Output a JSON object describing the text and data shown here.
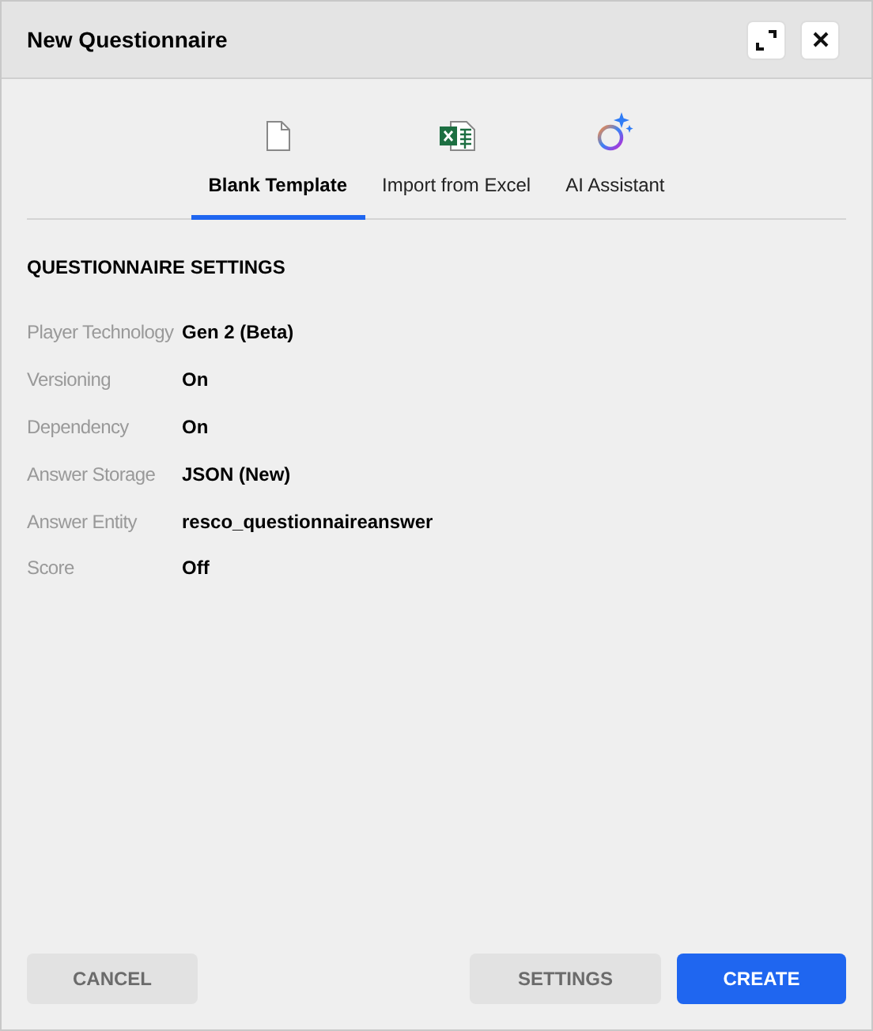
{
  "window": {
    "title": "New Questionnaire"
  },
  "tabs": [
    {
      "label": "Blank Template",
      "kind": "blank",
      "selected": true
    },
    {
      "label": "Import from Excel",
      "kind": "excel",
      "selected": false
    },
    {
      "label": "AI Assistant",
      "kind": "ai",
      "selected": false
    }
  ],
  "settings": {
    "heading": "QUESTIONNAIRE SETTINGS",
    "rows": [
      {
        "label": "Player Technology",
        "value": "Gen 2 (Beta)"
      },
      {
        "label": "Versioning",
        "value": "On"
      },
      {
        "label": "Dependency",
        "value": "On"
      },
      {
        "label": "Answer Storage",
        "value": "JSON (New)"
      },
      {
        "label": "Answer Entity",
        "value": "resco_questionnaireanswer"
      },
      {
        "label": "Score",
        "value": "Off"
      }
    ]
  },
  "buttons": [
    {
      "label": "CANCEL",
      "kind": "secondary"
    },
    {
      "label": "SETTINGS",
      "kind": "secondary"
    },
    {
      "label": "CREATE",
      "kind": "primary"
    }
  ]
}
